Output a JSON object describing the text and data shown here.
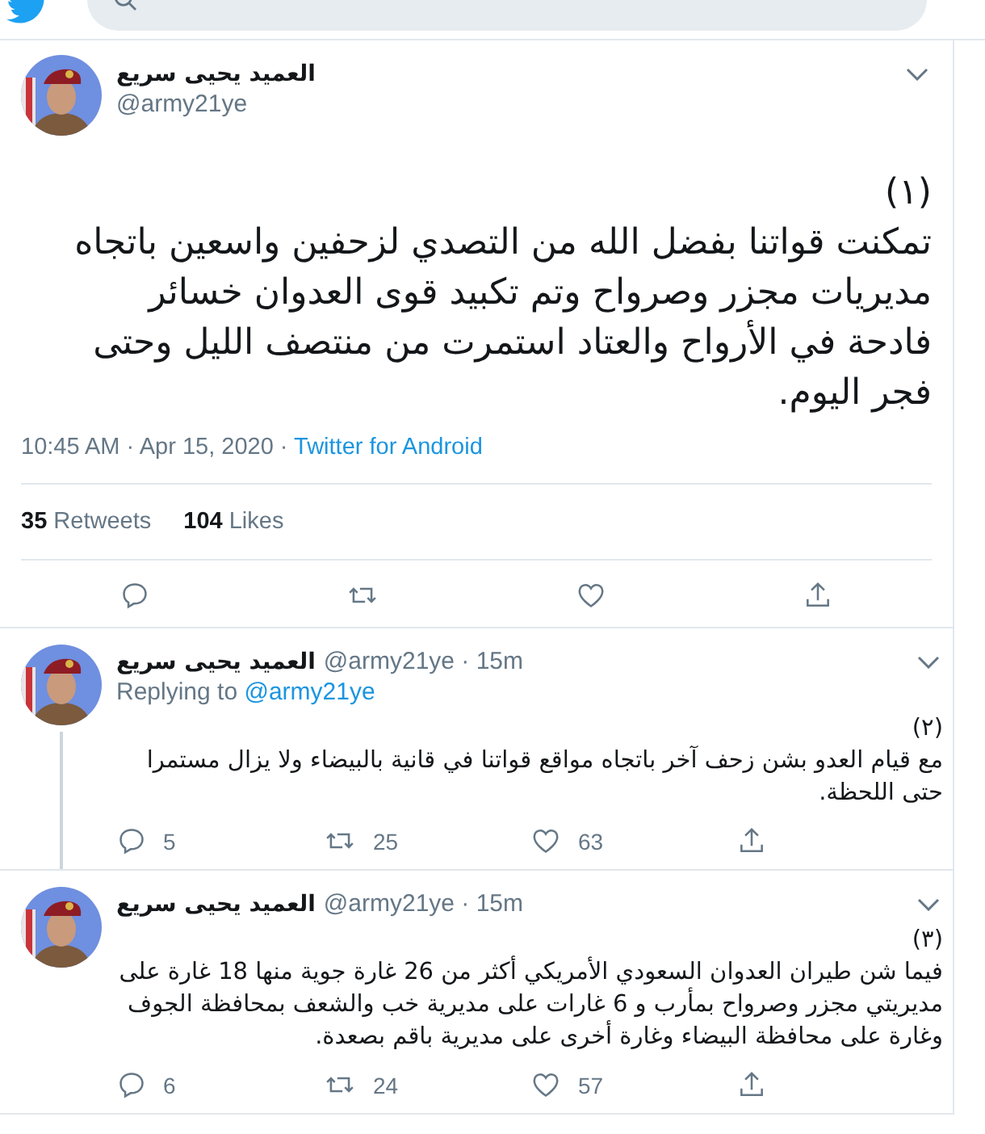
{
  "main_tweet": {
    "name": "العميد يحيى سريع",
    "handle": "@army21ye",
    "number": "(١)",
    "text": "تمكنت قواتنا بفضل الله من التصدي لزحفين واسعين باتجاه مديريات مجزر وصرواح وتم تكبيد قوى العدوان خسائر فادحة في الأرواح والعتاد استمرت من منتصف الليل وحتى فجر اليوم.",
    "time": "10:45 AM · Apr 15, 2020 ·",
    "source": "Twitter for Android",
    "retweets": {
      "count": "35",
      "label": "Retweets"
    },
    "likes": {
      "count": "104",
      "label": "Likes"
    }
  },
  "replies": [
    {
      "name": "العميد يحيى سريع",
      "handle": "@army21ye · 15m",
      "replying_to": {
        "label": "Replying to",
        "handle": "@army21ye"
      },
      "number": "(٢)",
      "text": "مع قيام العدو بشن زحف آخر باتجاه مواقع قواتنا في قانية بالبيضاء ولا يزال مستمرا حتى اللحظة.",
      "thread_line": true,
      "replies": "5",
      "retweets": "25",
      "likes": "63"
    },
    {
      "name": "العميد يحيى سريع",
      "handle": "@army21ye · 15m",
      "number": "(٣)",
      "text": "فيما شن طيران العدوان السعودي الأمريكي أكثر من 26 غارة جوية منها 18 غارة على مديريتي مجزر وصرواح بمأرب و 6 غارات على مديرية خب والشعف بمحافظة الجوف وغارة على محافظة البيضاء وغارة أخرى على مديرية باقم بصعدة.",
      "thread_line": false,
      "replies": "6",
      "retweets": "24",
      "likes": "57"
    }
  ]
}
